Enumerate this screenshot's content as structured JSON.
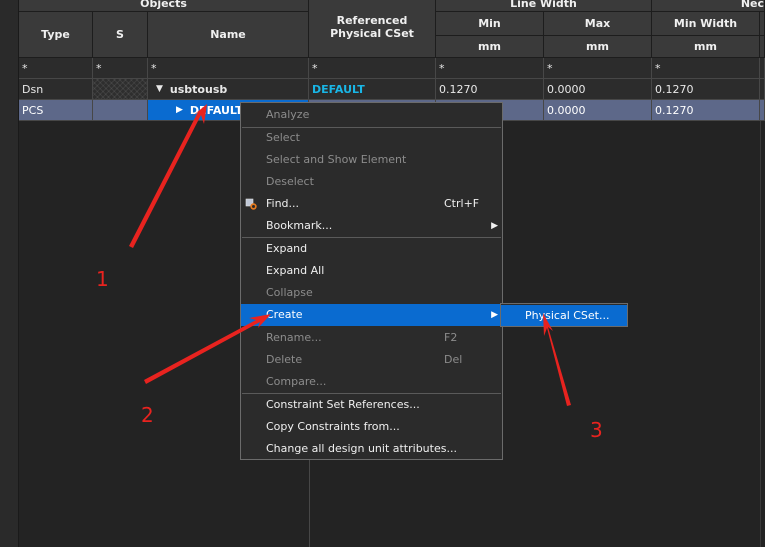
{
  "grid": {
    "group_headers": {
      "objects": "Objects",
      "line_width": "Line Width",
      "neck": "Nec"
    },
    "columns": {
      "type": "Type",
      "s": "S",
      "name": "Name",
      "ref_cset": "Referenced Physical CSet",
      "min": "Min",
      "max": "Max",
      "min_width": "Min Width"
    },
    "units": {
      "min": "mm",
      "max": "mm",
      "min_width": "mm"
    },
    "filter": {
      "type": "*",
      "s": "*",
      "name": "*",
      "ref_cset": "*",
      "min": "*",
      "max": "*",
      "min_width": "*"
    },
    "rows": [
      {
        "type": "Dsn",
        "s": "",
        "expander": "▼",
        "name": "usbtousb",
        "ref_cset": "DEFAULT",
        "min": "0.1270",
        "max": "0.0000",
        "min_width": "0.1270"
      },
      {
        "type": "PCS",
        "s": "",
        "expander": "▶",
        "name": "DEFAULT",
        "ref_cset": "",
        "min": "",
        "max": "0.0000",
        "min_width": "0.1270"
      }
    ]
  },
  "context_menu": {
    "items": [
      {
        "label": "Analyze",
        "enabled": false
      },
      {
        "label": "Select",
        "enabled": false
      },
      {
        "label": "Select and Show Element",
        "enabled": false
      },
      {
        "label": "Deselect",
        "enabled": false
      },
      {
        "label": "Find...",
        "shortcut": "Ctrl+F",
        "enabled": true,
        "icon": "find-icon"
      },
      {
        "label": "Bookmark...",
        "enabled": true,
        "submenu": true
      },
      {
        "label": "Expand",
        "enabled": true
      },
      {
        "label": "Expand All",
        "enabled": true
      },
      {
        "label": "Collapse",
        "enabled": false
      },
      {
        "label": "Create",
        "enabled": true,
        "submenu": true,
        "highlighted": true
      },
      {
        "label": "Rename...",
        "shortcut": "F2",
        "enabled": false
      },
      {
        "label": "Delete",
        "shortcut": "Del",
        "enabled": false
      },
      {
        "label": "Compare...",
        "enabled": false
      },
      {
        "label": "Constraint Set References...",
        "enabled": true
      },
      {
        "label": "Copy Constraints from...",
        "enabled": true
      },
      {
        "label": "Change all design unit attributes...",
        "enabled": true
      }
    ]
  },
  "submenu": {
    "items": [
      {
        "label": "Physical CSet...",
        "highlighted": true
      }
    ]
  },
  "annotations": {
    "labels": [
      "1",
      "2",
      "3"
    ],
    "color": "#e8231f"
  },
  "colors": {
    "accent": "#0a6bd0",
    "selected_row": "#5d6889",
    "cyan_text": "#19b6e6"
  }
}
